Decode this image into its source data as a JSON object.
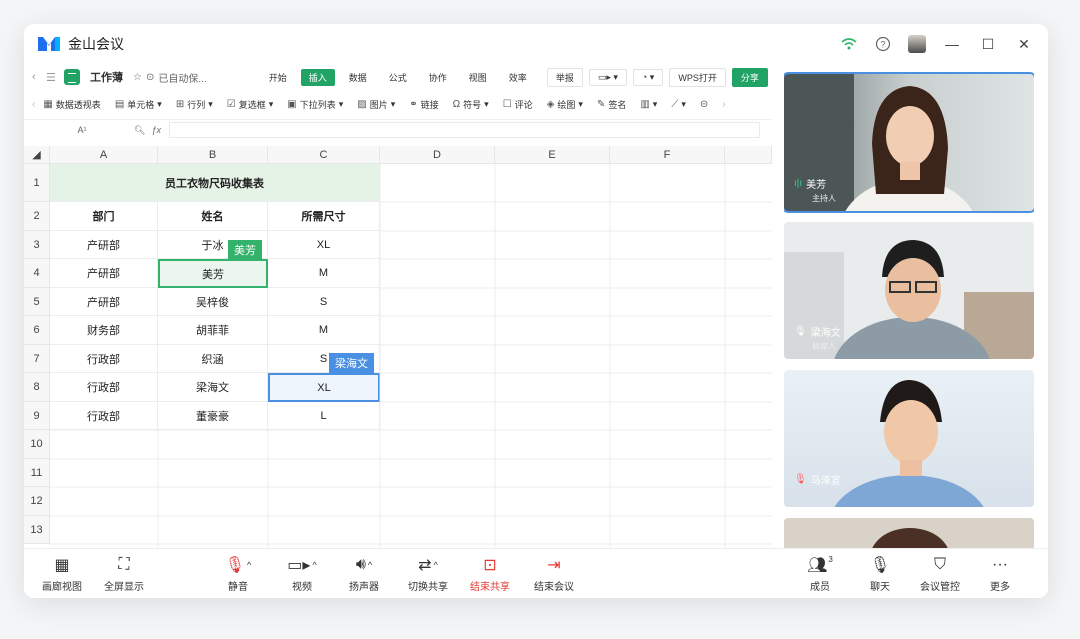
{
  "app": {
    "title": "金山会议"
  },
  "doc": {
    "name": "工作薄",
    "status": "已自动保...",
    "menu": [
      "开始",
      "插入",
      "数据",
      "公式",
      "协作",
      "视图",
      "效率"
    ],
    "active_menu": "插入",
    "buttons": {
      "report": "举报",
      "wps_open": "WPS打开",
      "share": "分享"
    }
  },
  "toolbar": {
    "items": [
      "数据透视表",
      "单元格",
      "行列",
      "复选框",
      "下拉列表",
      "图片",
      "链接",
      "符号",
      "评论",
      "绘图",
      "签名"
    ]
  },
  "formula": {
    "cellref": "A¹"
  },
  "sheet": {
    "columns": [
      "A",
      "B",
      "C",
      "D",
      "E",
      "F"
    ],
    "rows": [
      "1",
      "2",
      "3",
      "4",
      "5",
      "6",
      "7",
      "8",
      "9",
      "10",
      "11",
      "12",
      "13"
    ],
    "title": "员工衣物尺码收集表",
    "headers": [
      "部门",
      "姓名",
      "所需尺寸"
    ],
    "data": [
      [
        "产研部",
        "于冰",
        "XL"
      ],
      [
        "产研部",
        "美芳",
        "M"
      ],
      [
        "产研部",
        "吴梓俊",
        "S"
      ],
      [
        "财务部",
        "胡菲菲",
        "M"
      ],
      [
        "行政部",
        "织涵",
        "S"
      ],
      [
        "行政部",
        "梁海文",
        "XL"
      ],
      [
        "行政部",
        "董豪豪",
        "L"
      ]
    ],
    "cursor_tags": {
      "green": "美芳",
      "blue": "梁海文"
    }
  },
  "participants": [
    {
      "name": "美芳",
      "role": "主持人"
    },
    {
      "name": "梁海文",
      "role": "联席人"
    },
    {
      "name": "马泽宣",
      "role": ""
    }
  ],
  "bottom": {
    "gallery": "画廊视图",
    "fullscreen": "全屏显示",
    "mute": "静音",
    "video": "视频",
    "speaker": "扬声器",
    "switch_share": "切换共享",
    "end_share": "结束共享",
    "end_meeting": "结束会议",
    "members": "成员",
    "members_count": "3",
    "chat": "聊天",
    "control": "会议管控",
    "more": "更多"
  },
  "colors": {
    "accent_green": "#21a366",
    "select_blue": "#4a90e2",
    "danger": "#e53935"
  }
}
